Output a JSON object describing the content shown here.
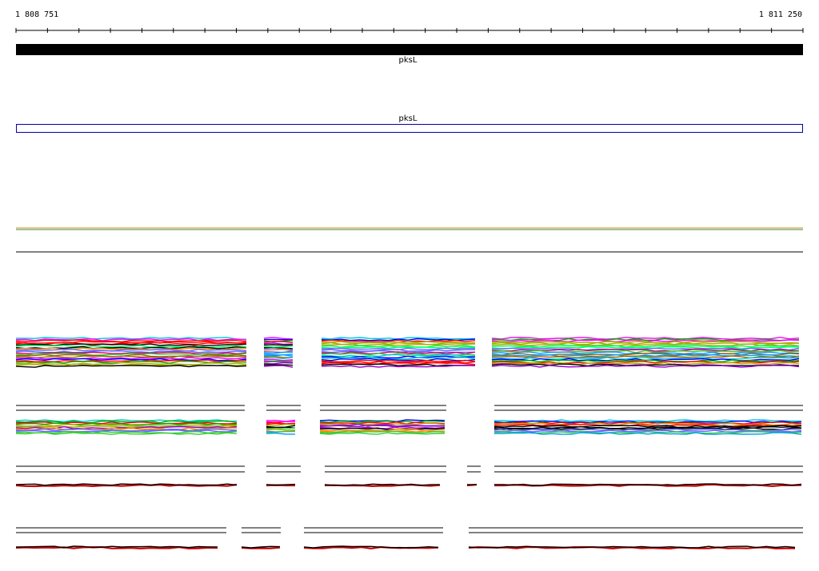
{
  "ruler": {
    "start_label": "1 808 751",
    "end_label": "1 811 250",
    "start_value": 1808751,
    "end_value": 1811250
  },
  "tracks": {
    "gene_label": "pksL",
    "cds_label": "pksL"
  },
  "colors": {
    "gene_bar": "#000000",
    "cds_box": "#0000aa",
    "line_orange": "#d98c1a",
    "line_green": "#3a8a3a",
    "line_black": "#000000",
    "line_red": "#cc0000"
  }
}
